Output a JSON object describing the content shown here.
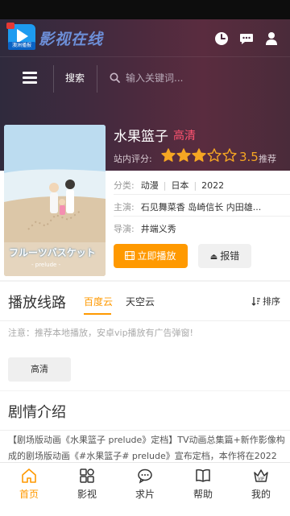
{
  "header": {
    "logo_caption": "澳洲播报",
    "brand": "影视在线",
    "icons": [
      "history-icon",
      "comment-icon",
      "user-icon"
    ]
  },
  "search": {
    "label": "搜索",
    "placeholder": "输入关键词..."
  },
  "movie": {
    "title": "水果篮子",
    "quality": "高清",
    "rating_label": "站内评分:",
    "rating": "3.5",
    "rating_stars": 3,
    "rating_max": 5,
    "recommend": "推荐",
    "category_label": "分类:",
    "category": "动漫",
    "region": "日本",
    "year": "2022",
    "cast_label": "主演:",
    "cast": "石见舞菜香  岛崎信长  内田雄...",
    "director_label": "导演:",
    "director": "井端义秀",
    "poster_title": "フルーツバスケット",
    "poster_sub": "- prelude -",
    "play_label": "立即播放",
    "report_label": "报错"
  },
  "sources": {
    "heading": "播放线路",
    "tabs": [
      {
        "label": "百度云",
        "active": true
      },
      {
        "label": "天空云",
        "active": false
      }
    ],
    "sort_label": "排序",
    "notice": "注意：推荐本地播放，安卓vip播放有广告弹窗!",
    "episodes": [
      "高清"
    ]
  },
  "synopsis": {
    "heading": "剧情介绍",
    "text": "【剧场版动画《水果篮子 prelude》定档】TV动画总集篇+新作影像构成的剧场版动画《#水果篮子# prelude》宣布定档，本作将在2022"
  },
  "tabbar": [
    {
      "label": "首页",
      "icon": "home-icon",
      "active": true
    },
    {
      "label": "影视",
      "icon": "grid-icon",
      "active": false
    },
    {
      "label": "求片",
      "icon": "chat-icon",
      "active": false
    },
    {
      "label": "帮助",
      "icon": "book-icon",
      "active": false
    },
    {
      "label": "我的",
      "icon": "vip-icon",
      "active": false
    }
  ],
  "colors": {
    "accent": "#ff9900",
    "quality": "#ff5370",
    "star": "#f5a623"
  }
}
